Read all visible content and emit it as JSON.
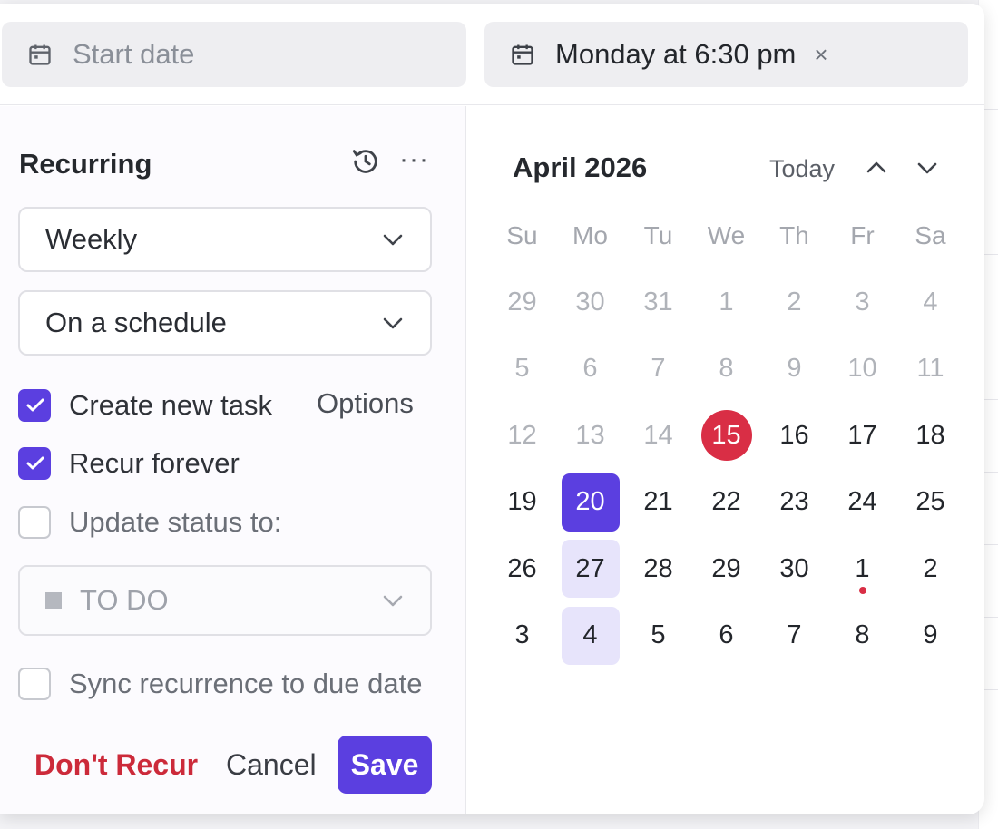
{
  "dates": {
    "start_placeholder": "Start date",
    "due_value": "Monday at 6:30 pm",
    "clear_glyph": "×"
  },
  "recurring": {
    "title": "Recurring",
    "history_icon": "history-icon",
    "more_glyph": "···",
    "frequency": "Weekly",
    "schedule": "On a schedule",
    "create_new_task": {
      "label": "Create new task",
      "checked": true
    },
    "options_label": "Options",
    "recur_forever": {
      "label": "Recur forever",
      "checked": true
    },
    "update_status": {
      "label": "Update status to:",
      "checked": false
    },
    "status_value": "TO DO",
    "sync_recurrence": {
      "label": "Sync recurrence to due date",
      "checked": false
    }
  },
  "actions": {
    "dont_recur": "Don't Recur",
    "cancel": "Cancel",
    "save": "Save"
  },
  "calendar": {
    "month": "April 2026",
    "today_label": "Today",
    "weekdays": [
      "Su",
      "Mo",
      "Tu",
      "We",
      "Th",
      "Fr",
      "Sa"
    ],
    "weeks": [
      [
        "29",
        "30",
        "31",
        "1",
        "2",
        "3",
        "4"
      ],
      [
        "5",
        "6",
        "7",
        "8",
        "9",
        "10",
        "11"
      ],
      [
        "12",
        "13",
        "14",
        "15",
        "16",
        "17",
        "18"
      ],
      [
        "19",
        "20",
        "21",
        "22",
        "23",
        "24",
        "25"
      ],
      [
        "26",
        "27",
        "28",
        "29",
        "30",
        "1",
        "2"
      ],
      [
        "3",
        "4",
        "5",
        "6",
        "7",
        "8",
        "9"
      ]
    ]
  },
  "colors": {
    "accent": "#5b3fe0",
    "today": "#d92e45",
    "recurrence_highlight": "#e7e4fb",
    "danger_text": "#cc2a3a"
  }
}
